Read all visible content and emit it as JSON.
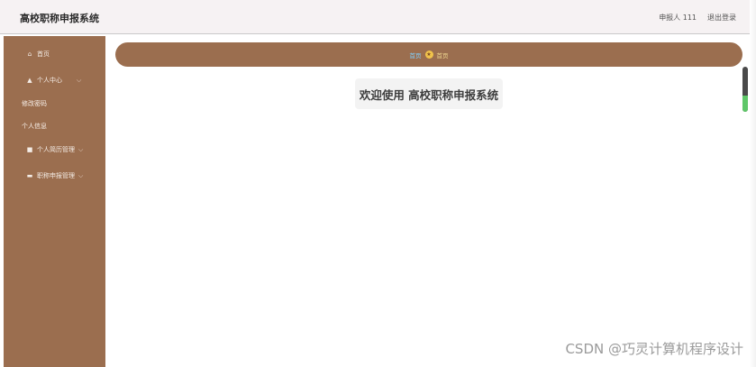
{
  "header": {
    "title": "高校职称申报系统",
    "user_label": "申报人 111",
    "logout_label": "退出登录"
  },
  "sidebar": {
    "items": [
      {
        "label": "首页",
        "icon": "home-icon",
        "chevron": ""
      },
      {
        "label": "个人中心",
        "icon": "user-icon",
        "chevron": "⌵"
      },
      {
        "label": "修改密码",
        "icon": "",
        "chevron": ""
      },
      {
        "label": "个人信息",
        "icon": "",
        "chevron": ""
      },
      {
        "label": "个人简历管理",
        "icon": "list-icon",
        "chevron": "⌵"
      },
      {
        "label": "职称申报管理",
        "icon": "doc-icon",
        "chevron": "⌵"
      }
    ]
  },
  "breadcrumb": {
    "home": "首页",
    "current": "首页"
  },
  "main": {
    "welcome": "欢迎使用 高校职称申报系统"
  },
  "watermark": "CSDN @巧灵计算机程序设计",
  "colors": {
    "sidebar_bg": "#9b6e4f",
    "header_bg": "#f6f2f3",
    "breadcrumb_home": "#7fd1ff"
  }
}
